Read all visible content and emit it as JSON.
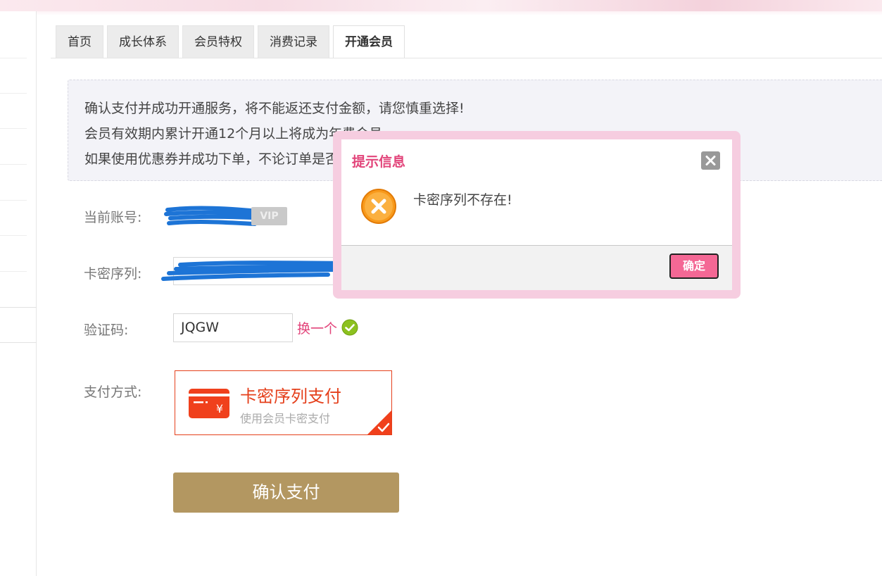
{
  "tabs": [
    {
      "label": "首页",
      "active": false
    },
    {
      "label": "成长体系",
      "active": false
    },
    {
      "label": "会员特权",
      "active": false
    },
    {
      "label": "消费记录",
      "active": false
    },
    {
      "label": "开通会员",
      "active": true
    }
  ],
  "notice": {
    "lines": [
      "确认支付并成功开通服务，将不能返还支付金额，请您慎重选择!",
      "会员有效期内累计开通12个月以上将成为年费会员。",
      "如果使用优惠券并成功下单，不论订单是否支付成功，优惠券都将被使用，请您谨慎使用订单。"
    ]
  },
  "form": {
    "account_label": "当前账号:",
    "vip_badge": "VIP",
    "card_label": "卡密序列:",
    "captcha_label": "验证码:",
    "captcha_value": "JQGW",
    "refresh_link": "换一个",
    "payment_label": "支付方式:",
    "payment_method": {
      "title": "卡密序列支付",
      "subtitle": "使用会员卡密支付",
      "icon": "card-yen-icon",
      "selected": true
    },
    "confirm_button": "确认支付"
  },
  "dialog": {
    "title": "提示信息",
    "message": "卡密序列不存在!",
    "ok_label": "确定",
    "icon": "error-x-icon"
  },
  "colors": {
    "accent_pink": "#e2447a",
    "pay_red": "#e5401c",
    "confirm_gold": "#b39761",
    "ok_pink": "#f46895"
  }
}
